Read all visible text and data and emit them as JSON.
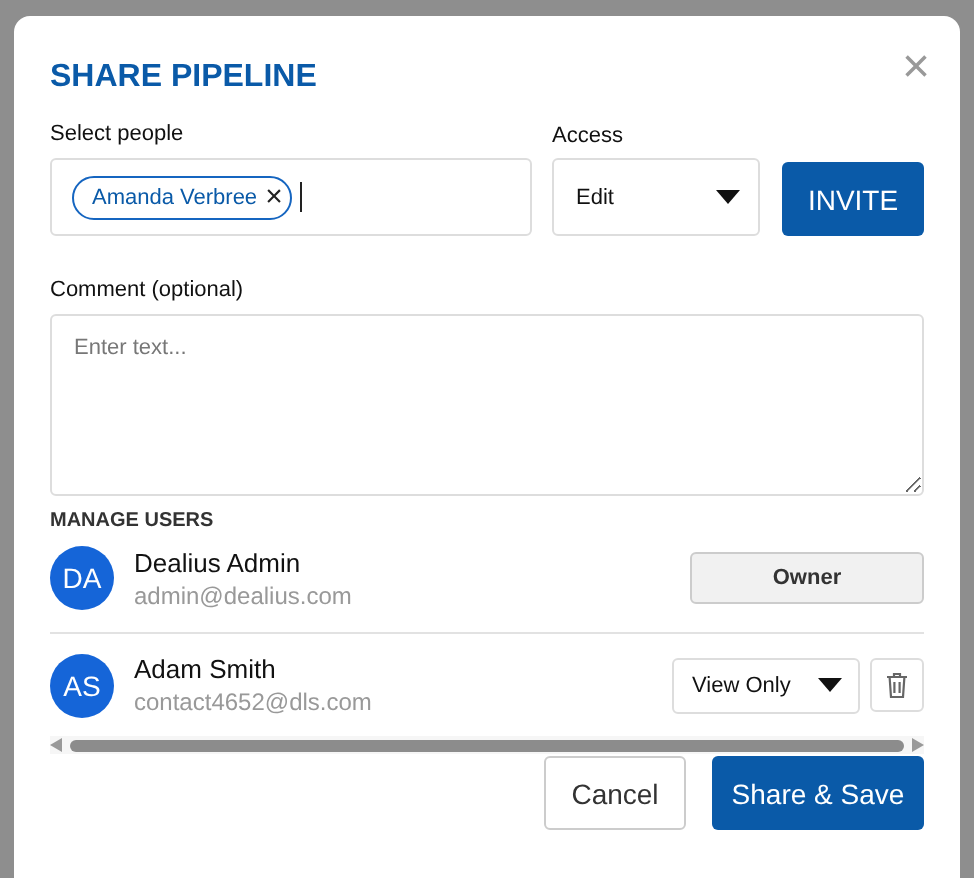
{
  "dialog": {
    "title": "SHARE PIPELINE",
    "close": "×"
  },
  "select_people": {
    "label": "Select people",
    "chips": [
      {
        "name": "Amanda Verbree",
        "remove": "×"
      }
    ]
  },
  "access": {
    "label": "Access",
    "value": "Edit"
  },
  "invite_button": "INVITE",
  "comment": {
    "label": "Comment (optional)",
    "placeholder": "Enter text..."
  },
  "manage_users": {
    "heading": "MANAGE USERS",
    "users": [
      {
        "initials": "DA",
        "name": "Dealius Admin",
        "email": "admin@dealius.com",
        "kind": "owner",
        "role": "Owner"
      },
      {
        "initials": "AS",
        "name": "Adam Smith",
        "email": "contact4652@dls.com",
        "kind": "select",
        "role": "View Only"
      }
    ]
  },
  "buttons": [
    {
      "label": "Cancel",
      "kind": "secondary"
    },
    {
      "label": "Share & Save",
      "kind": "primary"
    }
  ]
}
